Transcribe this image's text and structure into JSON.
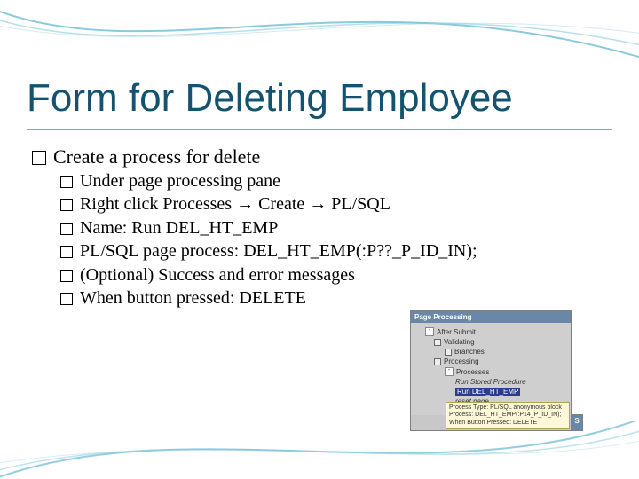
{
  "title": "Form for Deleting Employee",
  "bullets": {
    "main": "Create a process for delete",
    "sub1": "Under page processing pane",
    "sub2_pre": "Right click Processes ",
    "sub2_mid": " Create ",
    "sub2_post": " PL/SQL",
    "sub3": "Name: Run DEL_HT_EMP",
    "sub4": "PL/SQL page process: DEL_HT_EMP(:P??_P_ID_IN);",
    "sub5": "(Optional) Success and error messages",
    "sub6": "When button pressed: DELETE"
  },
  "arrow": "→",
  "shot": {
    "header": "Page Processing",
    "after_submit": "After Submit",
    "validating": "Validating",
    "branches": "Branches",
    "processing": "Processing",
    "processes": "Processes",
    "run_stored": "Run Stored Procedure",
    "run_del": "Run DEL_HT_EMP",
    "reset_page": "reset page",
    "tip1": "Process Type: PL/SQL anonymous block",
    "tip2": "Process: DEL_HT_EMP(:P14_P_ID_IN);",
    "tip3": "When Button Pressed: DELETE",
    "side_label": "S"
  }
}
